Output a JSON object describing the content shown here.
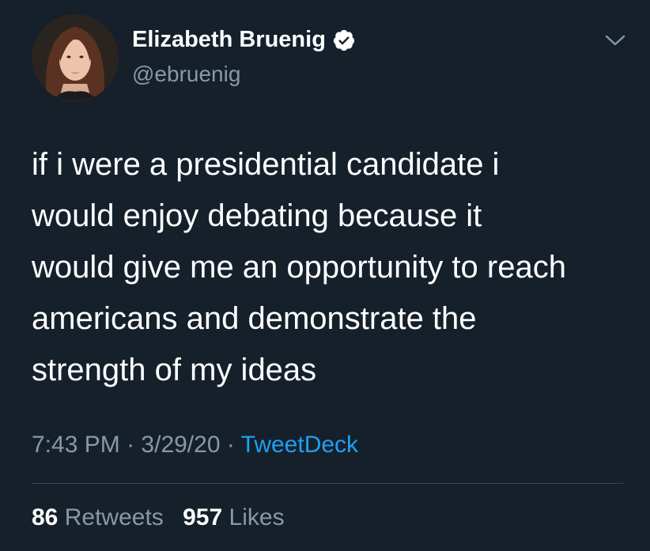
{
  "author": {
    "display_name": "Elizabeth Bruenig",
    "handle": "@ebruenig",
    "verified": true
  },
  "tweet": {
    "text_lines": [
      "if i were a presidential candidate i",
      "would enjoy debating because it",
      "would give me an opportunity to reach",
      "americans and demonstrate the",
      "strength of my ideas"
    ],
    "time": "7:43 PM",
    "separator": "·",
    "date": "3/29/20",
    "source": "TweetDeck"
  },
  "stats": {
    "retweets_count": "86",
    "retweets_label": "Retweets",
    "likes_count": "957",
    "likes_label": "Likes"
  },
  "colors": {
    "background": "#15202b",
    "text": "#ffffff",
    "secondary": "#8899a6",
    "accent": "#1da1f2",
    "divider": "#38444d"
  },
  "icons": {
    "verified": "verified-badge-icon",
    "menu": "chevron-down-icon"
  }
}
